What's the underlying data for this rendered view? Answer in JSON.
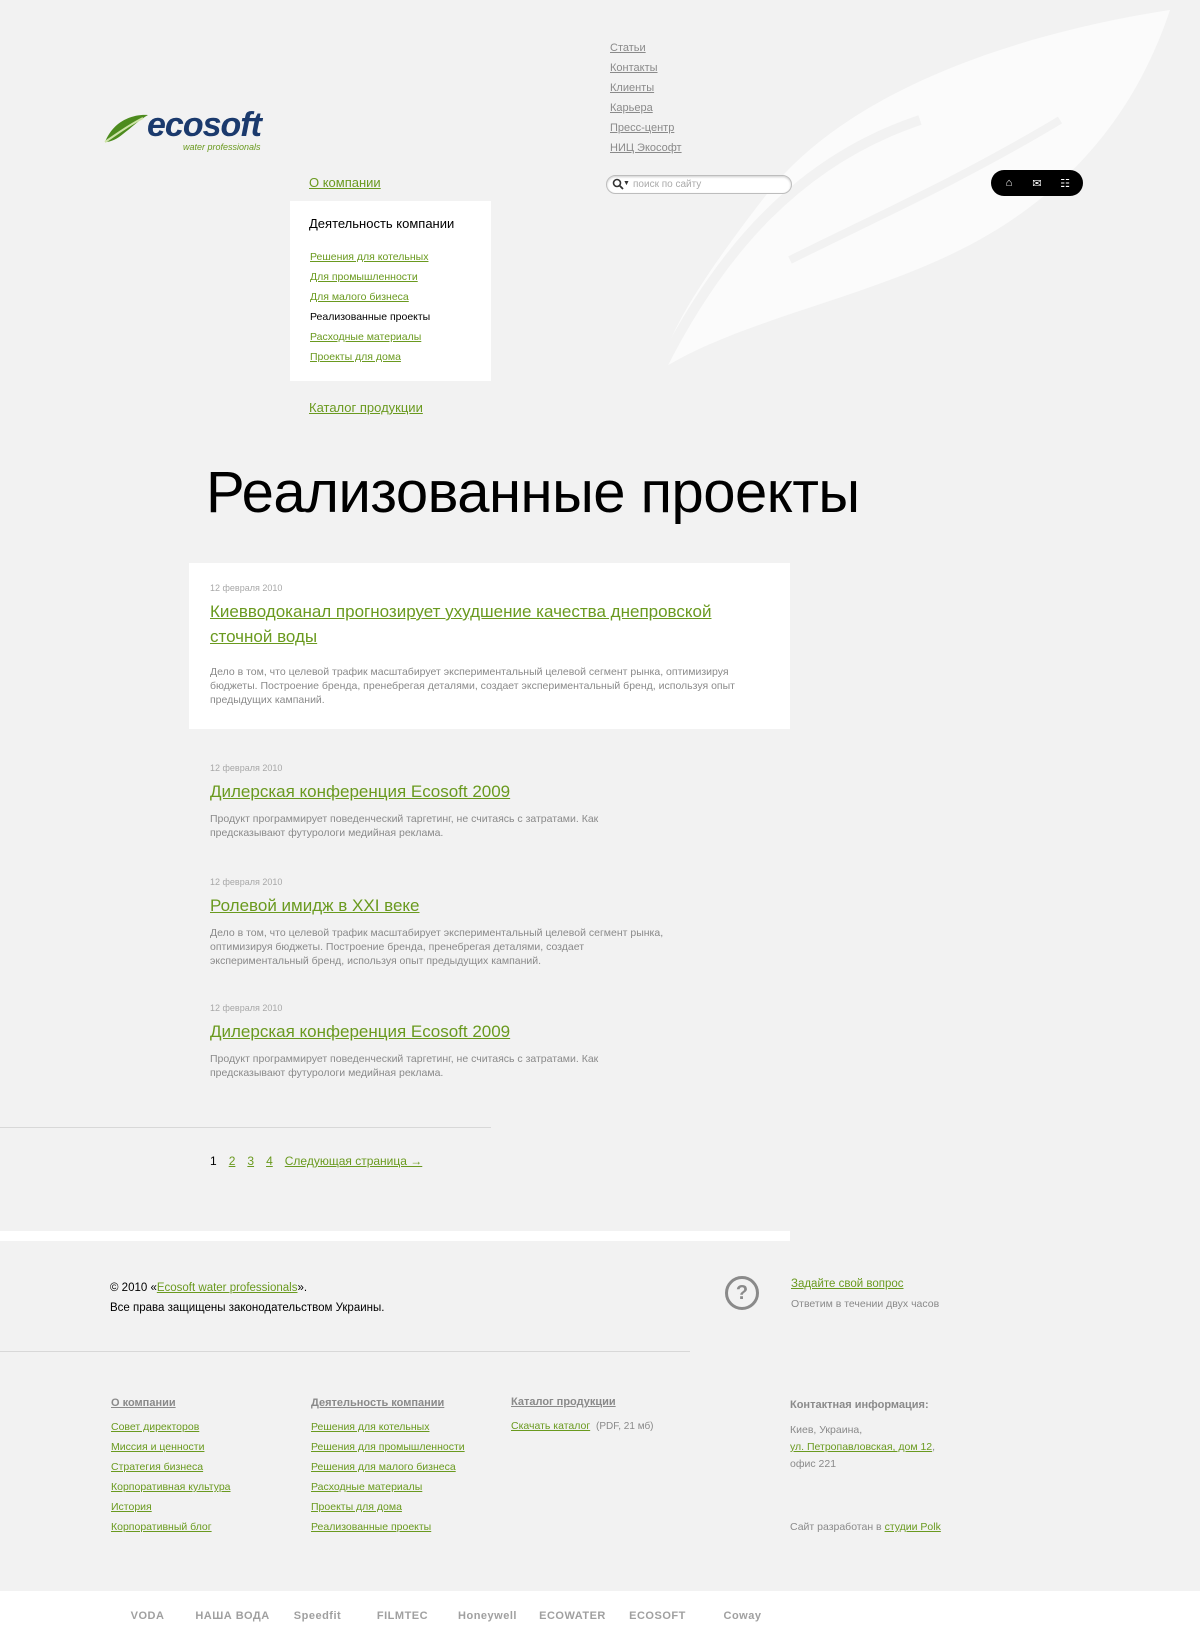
{
  "logo": {
    "name": "ecosoft",
    "tagline": "water professionals"
  },
  "top_links": [
    "Статьи",
    "Контакты",
    "Клиенты",
    "Карьера",
    "Пресс-центр",
    "НИЦ Экософт"
  ],
  "search": {
    "placeholder": "поиск по сайту"
  },
  "icons": [
    "home-icon",
    "mail-icon",
    "sitemap-icon"
  ],
  "nav": {
    "about": "О компании",
    "activity": "Деятельность компании",
    "items": [
      "Решения для котельных",
      "Для промышленности",
      "Для малого бизнеса",
      "Реализованные проекты",
      "Расходные материалы",
      "Проекты для дома"
    ],
    "current_index": 3,
    "catalog": "Каталог продукции"
  },
  "page_title": "Реализованные проекты",
  "articles": [
    {
      "date": "12 февраля 2010",
      "title": "Киевводоканал прогнозирует ухудшение качества днепровской сточной воды",
      "text": "Дело в том, что целевой трафик масштабирует экспериментальный целевой сегмент рынка, оптимизируя бюджеты. Построение бренда, пренебрегая деталями, создает экспериментальный бренд, используя опыт предыдущих кампаний."
    },
    {
      "date": "12 февраля 2010",
      "title": "Дилерская конференция Ecosoft 2009",
      "text": "Продукт программирует поведенческий таргетинг, не считаясь с затратами. Как предсказывают футурологи медийная реклама."
    },
    {
      "date": "12 февраля 2010",
      "title": "Ролевой имидж в XXI веке",
      "text": "Дело в том, что целевой трафик масштабирует экспериментальный целевой сегмент рынка, оптимизируя бюджеты. Построение бренда, пренебрегая деталями, создает экспериментальный бренд, используя опыт предыдущих кампаний."
    },
    {
      "date": "12 февраля 2010",
      "title": "Дилерская конференция Ecosoft 2009",
      "text": "Продукт программирует поведенческий таргетинг, не считаясь с затратами. Как предсказывают футурологи медийная реклама."
    }
  ],
  "pager": {
    "pages": [
      "1",
      "2",
      "3",
      "4"
    ],
    "current": "1",
    "next": "Следующая страница →"
  },
  "footer": {
    "copy_prefix": "© 2010 «",
    "copy_link": "Ecosoft water professionals",
    "copy_suffix": "».",
    "rights": "Все права защищены законодательством Украины.",
    "ask": "Задайте свой вопрос",
    "ask_sub": "Ответим в течении двух часов",
    "col1": {
      "title": "О компании",
      "items": [
        "Совет директоров",
        "Миссия и ценности",
        "Стратегия бизнеса",
        "Корпоративная культура",
        "История",
        "Корпоративный блог"
      ]
    },
    "col2": {
      "title": "Деятельность компании",
      "items": [
        "Решения для котельных",
        "Решения для промышленности",
        "Решения для малого бизнеса",
        "Расходные материалы",
        "Проекты для дома",
        "Реализованные проекты"
      ]
    },
    "col3": {
      "title": "Каталог продукции",
      "download": "Скачать каталог",
      "download_meta": "(PDF, 21 мб)"
    },
    "contact": {
      "title": "Контактная информация:",
      "city": "Киев, Украина,",
      "street": "ул. Петропавловская, дом 12",
      "comma": ",",
      "office": "офис 221"
    },
    "dev_prefix": "Сайт разработан в ",
    "dev_link": "студии Polk"
  },
  "brands": [
    "VODA",
    "НАША ВОДА",
    "Speedfit",
    "FILMTEC",
    "Honeywell",
    "ECOWATER",
    "ECOSOFT",
    "Coway"
  ],
  "colors": {
    "link": "#6a9a1f",
    "logo_blue": "#1b3a6d",
    "muted": "#8a8a8a",
    "background": "#f2f2f2"
  }
}
